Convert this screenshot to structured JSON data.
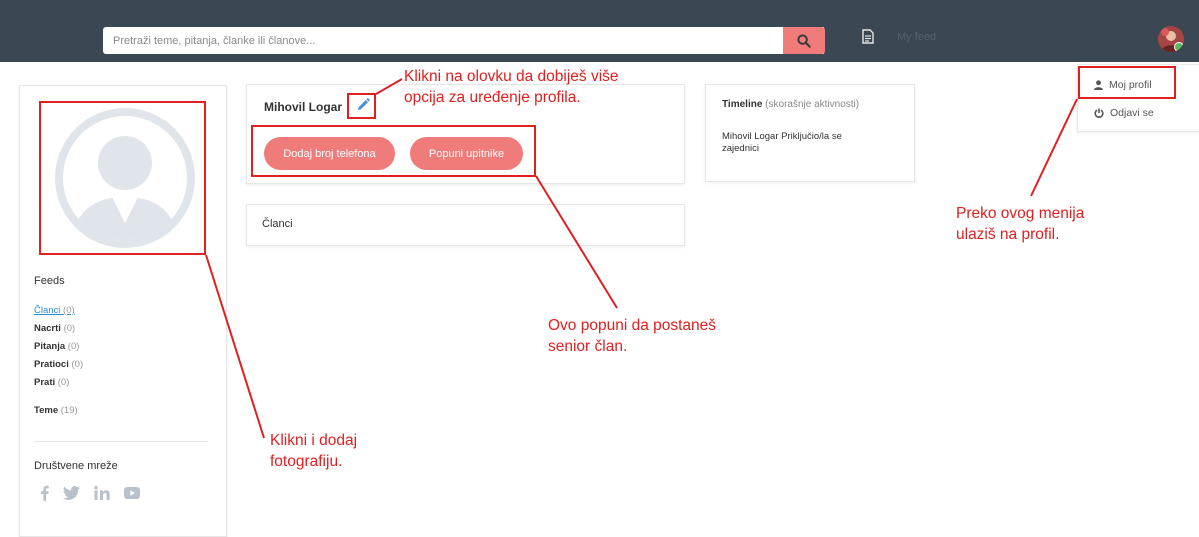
{
  "header": {
    "search_placeholder": "Pretraži teme, pitanja, članke ili članove...",
    "feed_label": "My feed",
    "icons": {
      "search": "search-icon",
      "feed": "document-icon",
      "avatar": "user-avatar"
    }
  },
  "sidebar": {
    "feeds_title": "Feeds",
    "items": [
      {
        "label": "Članci",
        "count": "(0)"
      },
      {
        "label": "Nacrti",
        "count": "(0)"
      },
      {
        "label": "Pitanja",
        "count": "(0)"
      },
      {
        "label": "Pratioci",
        "count": "(0)"
      },
      {
        "label": "Prati",
        "count": "(0)"
      },
      {
        "label": "Teme",
        "count": "(19)"
      }
    ],
    "social_title": "Društvene mreže",
    "social_icons": [
      "facebook-icon",
      "twitter-icon",
      "linkedin-icon",
      "youtube-icon"
    ]
  },
  "profile": {
    "name": "Mihovil Logar",
    "add_phone_label": "Dodaj broj telefona",
    "questionnaire_label": "Popuni upitnike"
  },
  "articles": {
    "title": "Članci"
  },
  "timeline": {
    "title": "Timeline",
    "subtitle": "(skorašnje aktivnosti)",
    "entry": "Mihovil Logar Priključio/la se zajednici"
  },
  "user_menu": {
    "items": [
      {
        "label": "Moj profil",
        "icon": "user-icon"
      },
      {
        "label": "Odjavi se",
        "icon": "power-icon"
      }
    ]
  },
  "annotations": {
    "pencil_hint": "Klikni na olovku da dobiješ više opcija za uređenje profila.",
    "pencil_hint_line1": "Klikni na olovku da dobiješ više",
    "pencil_hint_line2": "opcija za uređenje profila.",
    "menu_hint_line1": "Preko ovog menija",
    "menu_hint_line2": "ulaziš na profil.",
    "fill_hint_line1": "Ovo popuni da postaneš",
    "fill_hint_line2": "senior član.",
    "photo_hint_line1": "Klikni i dodaj",
    "photo_hint_line2": "fotografiju."
  },
  "colors": {
    "topbar": "#3b4753",
    "accent": "#f07b7b",
    "annotation": "#e02020",
    "link": "#2a8fd5"
  }
}
